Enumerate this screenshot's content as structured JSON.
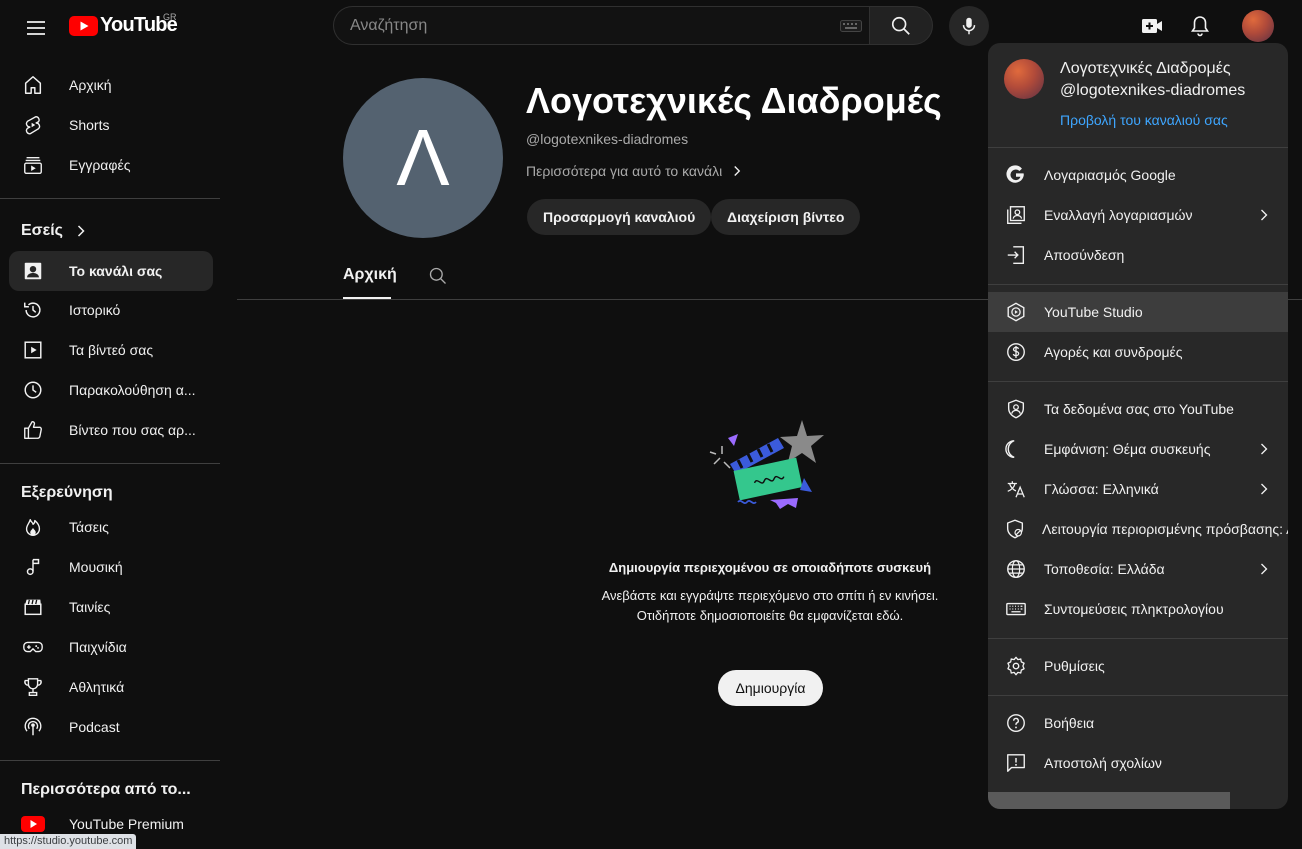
{
  "colors": {
    "background": "#0f0f0f",
    "brand_red": "#ff0000",
    "link_blue": "#3ea6ff",
    "panel": "#282828",
    "hover": "#3d3d3d"
  },
  "header": {
    "logo_text": "YouTube",
    "country_code": "GR",
    "search_placeholder": "Αναζήτηση",
    "icons": [
      "menu-icon",
      "search-icon",
      "mic-icon",
      "create-icon",
      "bell-icon"
    ]
  },
  "sidebar": {
    "main": [
      {
        "label": "Αρχική",
        "icon": "home-icon"
      },
      {
        "label": "Shorts",
        "icon": "shorts-icon"
      },
      {
        "label": "Εγγραφές",
        "icon": "subscriptions-icon"
      }
    ],
    "you_heading": "Εσείς",
    "you": [
      {
        "label": "Το κανάλι σας",
        "icon": "channel-icon",
        "active": true
      },
      {
        "label": "Ιστορικό",
        "icon": "history-icon"
      },
      {
        "label": "Τα βίντεό σας",
        "icon": "your-videos-icon"
      },
      {
        "label": "Παρακολούθηση α...",
        "icon": "watch-later-icon"
      },
      {
        "label": "Βίντεο που σας αρ...",
        "icon": "liked-icon"
      }
    ],
    "explore_heading": "Εξερεύνηση",
    "explore": [
      {
        "label": "Τάσεις",
        "icon": "trending-icon"
      },
      {
        "label": "Μουσική",
        "icon": "music-icon"
      },
      {
        "label": "Ταινίες",
        "icon": "movies-icon"
      },
      {
        "label": "Παιχνίδια",
        "icon": "gaming-icon"
      },
      {
        "label": "Αθλητικά",
        "icon": "sports-icon"
      },
      {
        "label": "Podcast",
        "icon": "podcast-icon"
      }
    ],
    "more_heading": "Περισσότερα από το...",
    "more": [
      {
        "label": "YouTube Premium",
        "icon": "youtube-premium-icon"
      }
    ]
  },
  "status_url": "https://studio.youtube.com",
  "channel": {
    "avatar_letter": "Λ",
    "name": "Λογοτεχνικές Διαδρομές",
    "handle": "@logotexnikes-diadromes",
    "more_link": "Περισσότερα για αυτό το κανάλι",
    "customize_button": "Προσαρμογή καναλιού",
    "manage_button": "Διαχείριση βίντεο",
    "tab_home": "Αρχική"
  },
  "empty_state": {
    "title": "Δημιουργία περιεχομένου σε οποιαδήποτε συσκευή",
    "body": "Ανεβάστε και εγγράψτε περιεχόμενο στο σπίτι ή εν κινήσει. Οτιδήποτε δημοσιοποιείτε θα εμφανίζεται εδώ.",
    "button": "Δημιουργία"
  },
  "account_menu": {
    "name": "Λογοτεχνικές Διαδρομές",
    "handle": "@logotexnikes-diadromes",
    "view_channel": "Προβολή του καναλιού σας",
    "sections": [
      [
        {
          "label": "Λογαριασμός Google",
          "icon": "google-icon"
        },
        {
          "label": "Εναλλαγή λογαριασμών",
          "icon": "switch-account-icon",
          "chevron": true
        },
        {
          "label": "Αποσύνδεση",
          "icon": "sign-out-icon"
        }
      ],
      [
        {
          "label": "YouTube Studio",
          "icon": "youtube-studio-icon",
          "hover": true
        },
        {
          "label": "Αγορές και συνδρομές",
          "icon": "dollar-icon"
        }
      ],
      [
        {
          "label": "Τα δεδομένα σας στο YouTube",
          "icon": "shield-person-icon"
        },
        {
          "label": "Εμφάνιση: Θέμα συσκευής",
          "icon": "moon-icon",
          "chevron": true
        },
        {
          "label": "Γλώσσα: Ελληνικά",
          "icon": "translate-icon",
          "chevron": true
        },
        {
          "label": "Λειτουργία περιορισμένης πρόσβασης: Ανενεργή",
          "icon": "restricted-icon",
          "chevron": true
        },
        {
          "label": "Τοποθεσία: Ελλάδα",
          "icon": "globe-icon",
          "chevron": true
        },
        {
          "label": "Συντομεύσεις πληκτρολογίου",
          "icon": "keyboard-icon"
        }
      ],
      [
        {
          "label": "Ρυθμίσεις",
          "icon": "settings-icon"
        }
      ],
      [
        {
          "label": "Βοήθεια",
          "icon": "help-icon"
        },
        {
          "label": "Αποστολή σχολίων",
          "icon": "feedback-icon"
        }
      ]
    ]
  }
}
